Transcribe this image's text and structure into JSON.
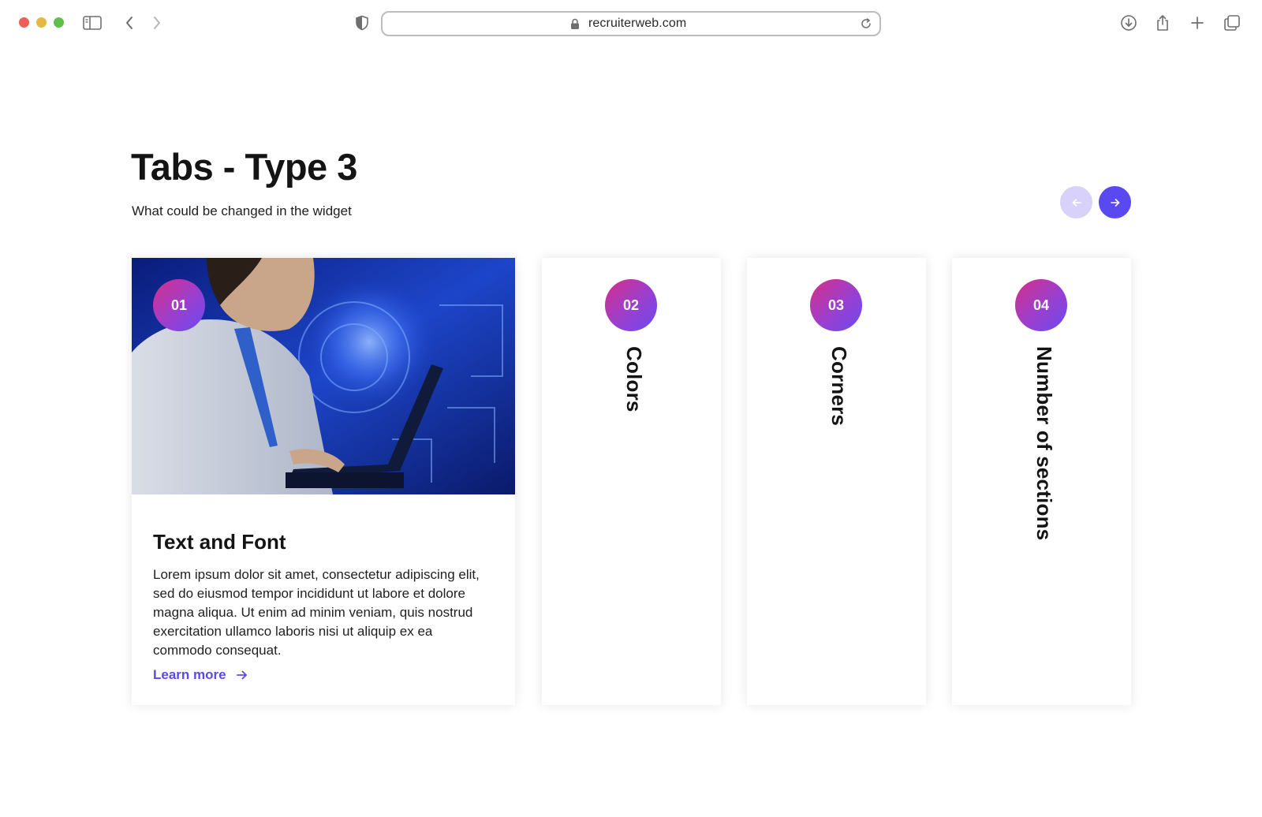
{
  "browser": {
    "url": "recruiterweb.com"
  },
  "page": {
    "title": "Tabs - Type 3",
    "subtitle": "What could be changed in the widget"
  },
  "tabs": [
    {
      "number": "01",
      "label": "Text and Font",
      "body": "Lorem ipsum dolor sit amet, consectetur adipiscing elit, sed do eiusmod tempor incididunt ut labore et dolore magna aliqua. Ut enim ad minim veniam, quis nostrud exercitation ullamco laboris nisi ut aliquip ex ea commodo consequat.",
      "link": "Learn more",
      "active": true
    },
    {
      "number": "02",
      "label": "Colors",
      "active": false
    },
    {
      "number": "03",
      "label": "Corners",
      "active": false
    },
    {
      "number": "04",
      "label": "Number of sections",
      "active": false
    }
  ],
  "colors": {
    "accent": "#5a49f0",
    "accent_disabled": "#d8d2fb",
    "badge_gradient_start": "#d62f86",
    "badge_gradient_end": "#6a4af0"
  }
}
